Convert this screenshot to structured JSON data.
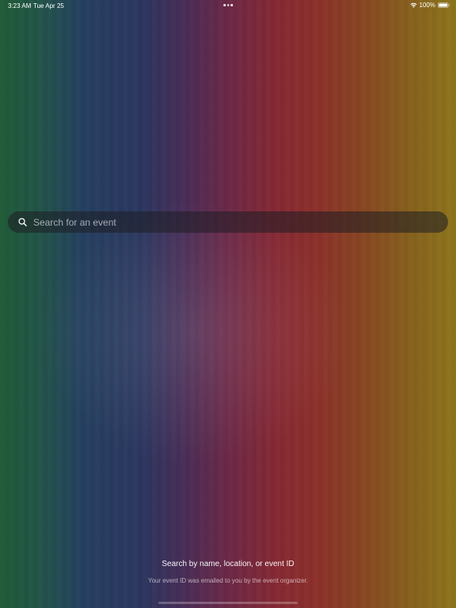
{
  "status_bar": {
    "time": "3:23 AM",
    "date": "Tue Apr 25",
    "battery": "100%",
    "wifi_icon": "wifi-icon",
    "battery_icon": "battery-icon"
  },
  "search": {
    "placeholder": "Search for an event",
    "value": "",
    "icon": "search-icon"
  },
  "hint": {
    "title": "Search by name, location, or event ID",
    "subtitle": "Your event ID was emailed to you by the event organizer."
  },
  "colors": {
    "green": "#1f5a36",
    "blue": "#243f5f",
    "purple": "#4a2c55",
    "red": "#842834",
    "orange": "#874223",
    "yellow": "#8c751c",
    "search_bg": "#1e1e23"
  }
}
